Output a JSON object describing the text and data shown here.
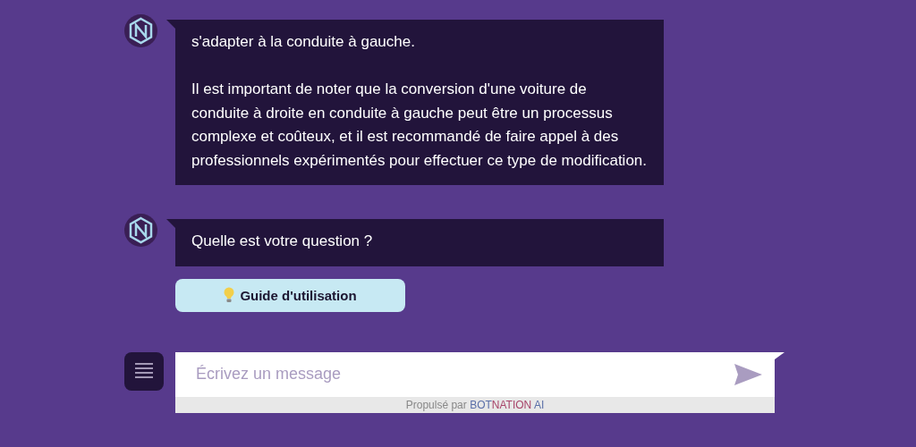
{
  "messages": [
    {
      "paragraphs": [
        "s'adapter à la conduite à gauche.",
        "Il est important de noter que la conversion d'une voiture de conduite à droite en conduite à gauche peut être un processus complexe et coûteux, et il est recommandé de faire appel à des professionnels expérimentés pour effectuer ce type de modification."
      ]
    },
    {
      "paragraphs": [
        "Quelle est votre question ?"
      ]
    }
  ],
  "quick_replies": [
    {
      "label": "Guide d'utilisation"
    }
  ],
  "composer": {
    "placeholder": "Écrivez un message"
  },
  "powered_by": {
    "prefix": "Propulsé par",
    "brand": [
      {
        "text": "BOT",
        "color": "#5a6fa8"
      },
      {
        "text": "NATION",
        "color": "#a8456a"
      },
      {
        "text": " AI",
        "color": "#5a6fa8"
      }
    ]
  }
}
